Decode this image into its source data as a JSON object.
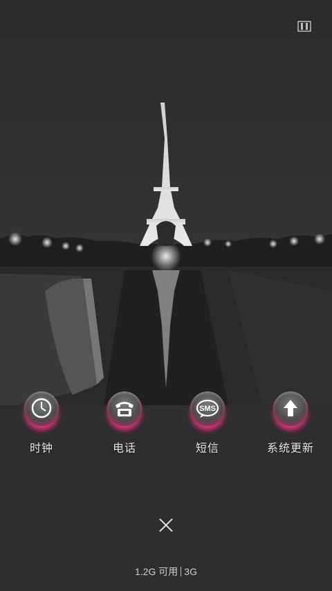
{
  "shortcuts": [
    {
      "label": "时钟",
      "icon": "clock-icon"
    },
    {
      "label": "电话",
      "icon": "phone-icon"
    },
    {
      "label": "短信",
      "icon": "sms-icon",
      "badge_text": "SMS"
    },
    {
      "label": "系统更新",
      "icon": "update-arrow-icon"
    }
  ],
  "status_bar": {
    "memory": "1.2G 可用",
    "network": "3G"
  },
  "colors": {
    "accent_pink": "#e0307a",
    "overlay": "#2b2b2b"
  }
}
